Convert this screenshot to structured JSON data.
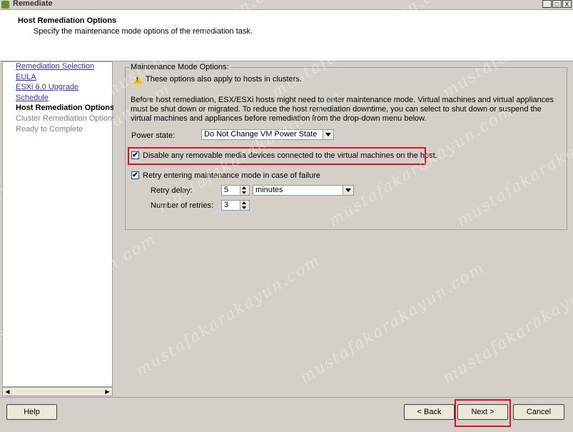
{
  "window": {
    "title": "Remediate",
    "minimize": "_",
    "maximize": "□",
    "close": "X"
  },
  "header": {
    "title": "Host Remediation Options",
    "subtitle": "Specify the maintenance mode options of the remediation task."
  },
  "nav": {
    "items": [
      {
        "label": "Remediation Selection"
      },
      {
        "label": "EULA"
      },
      {
        "label": "ESXi 6.0 Upgrade"
      },
      {
        "label": "Schedule"
      },
      {
        "label": "Host Remediation Options"
      },
      {
        "label": "Cluster Remediation Options"
      },
      {
        "label": "Ready to Complete"
      }
    ]
  },
  "main": {
    "group_title": "Maintenance Mode Options:",
    "warning_text": "These options also apply to hosts in clusters.",
    "description": "Before host remediation, ESX/ESXi hosts might need to enter maintenance mode. Virtual machines and virtual appliances must be shut down or migrated. To reduce the host remediation downtime, you can select to shut down or suspend the virtual machines and appliances before remediation from the drop-down menu below.",
    "power_state_label": "Power state:",
    "power_state_value": "Do Not Change VM Power State",
    "disable_media_label": "Disable any removable media devices connected to the virtual machines on the host.",
    "disable_media_check": "✔",
    "retry_label": "Retry entering maintenance mode in case of failure",
    "retry_check": "✔",
    "retry_delay_label": "Retry delay:",
    "retry_delay_value": "5",
    "retry_delay_unit": "minutes",
    "retries_label": "Number of retries:",
    "retries_value": "3"
  },
  "footer": {
    "help": "Help",
    "back": "< Back",
    "next": "Next >",
    "cancel": "Cancel"
  },
  "colors": {
    "highlight": "#e01020",
    "link": "#3333cc"
  },
  "watermark": "mustafakarakayun.com"
}
